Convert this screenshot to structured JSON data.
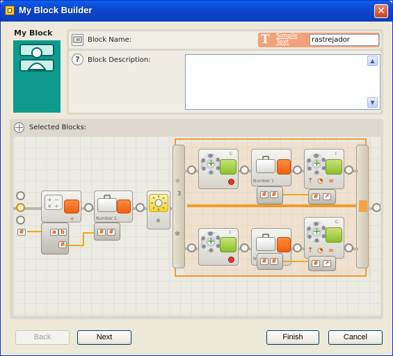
{
  "window": {
    "title": "My Block Builder",
    "close_label": "✕"
  },
  "my_block": {
    "label": "My Block"
  },
  "block_name": {
    "label": "Block Name:",
    "value": "rastrejador"
  },
  "simple_text": {
    "label": "Simple Text",
    "icon": "T"
  },
  "block_description": {
    "label": "Block Description:",
    "value": ""
  },
  "selected_blocks": {
    "label": "Selected Blocks:",
    "switch_value": "3",
    "blocks": [
      {
        "name": "math-block",
        "kind": "math"
      },
      {
        "name": "variable-block-1",
        "kind": "variable",
        "label": "Number 1"
      },
      {
        "name": "sensor-block",
        "kind": "light-sensor"
      },
      {
        "name": "motor-c-top",
        "kind": "motor",
        "port": "C"
      },
      {
        "name": "variable-top",
        "kind": "variable",
        "label": "Number 1"
      },
      {
        "name": "motor-i-top",
        "kind": "motor",
        "port": "I"
      },
      {
        "name": "motor-i-bottom",
        "kind": "motor",
        "port": "I"
      },
      {
        "name": "variable-bottom",
        "kind": "variable",
        "label": "Number 1"
      },
      {
        "name": "motor-c-bottom",
        "kind": "motor",
        "port": "C"
      }
    ]
  },
  "buttons": {
    "back": "Back",
    "next": "Next",
    "finish": "Finish",
    "cancel": "Cancel"
  },
  "icons": {
    "name_icon": "name-tag-icon",
    "help_icon": "question-icon",
    "selected_icon": "crosshair-icon"
  },
  "colors": {
    "titlebar": "#0a4fd6",
    "simple_text_accent": "#f2a17a",
    "my_block_tile": "#0e9a8c",
    "wire": "#f2a51a",
    "motor_green": "#8cbf2a",
    "variable_orange": "#f06010"
  }
}
